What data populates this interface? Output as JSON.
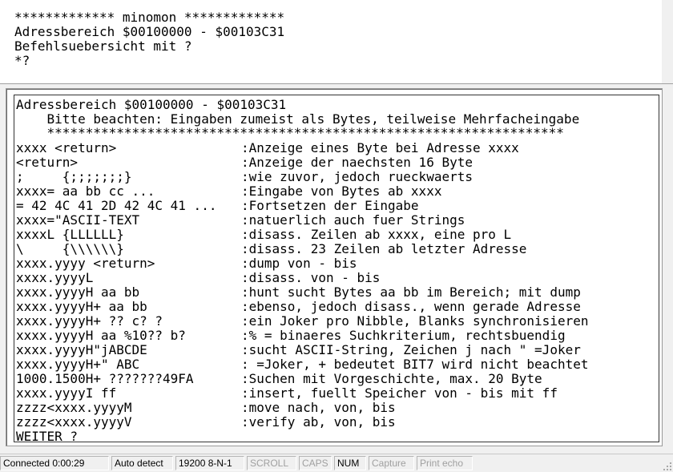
{
  "terminal": {
    "lines": [
      "************* minomon *************",
      "Adressbereich $00100000 - $00103C31",
      "Befehlsuebersicht mit ?",
      "*?"
    ]
  },
  "help": {
    "header": "Adressbereich $00100000 - $00103C31",
    "notice": "    Bitte beachten: Eingaben zumeist als Bytes, teilweise Mehrfacheingabe",
    "separator": "    *******************************************************************",
    "commands": [
      {
        "cmd": "xxxx <return>",
        "desc": ":Anzeige eines Byte bei Adresse xxxx"
      },
      {
        "cmd": "<return>",
        "desc": ":Anzeige der naechsten 16 Byte"
      },
      {
        "cmd": ";     {;;;;;;;}",
        "desc": ":wie zuvor, jedoch rueckwaerts"
      },
      {
        "cmd": "xxxx= aa bb cc ...",
        "desc": ":Eingabe von Bytes ab xxxx"
      },
      {
        "cmd": "= 42 4C 41 2D 42 4C 41 ...",
        "desc": ":Fortsetzen der Eingabe"
      },
      {
        "cmd": "xxxx=\"ASCII-TEXT",
        "desc": ":natuerlich auch fuer Strings"
      },
      {
        "cmd": "xxxxL {LLLLLL}",
        "desc": ":disass. Zeilen ab xxxx, eine pro L"
      },
      {
        "cmd": "\\     {\\\\\\\\\\\\}",
        "desc": ":disass. 23 Zeilen ab letzter Adresse"
      },
      {
        "cmd": "xxxx.yyyy <return>",
        "desc": ":dump von - bis"
      },
      {
        "cmd": "xxxx.yyyyL",
        "desc": ":disass. von - bis"
      },
      {
        "cmd": "xxxx.yyyyH aa bb",
        "desc": ":hunt sucht Bytes aa bb im Bereich; mit dump"
      },
      {
        "cmd": "xxxx.yyyyH+ aa bb",
        "desc": ":ebenso, jedoch disass., wenn gerade Adresse"
      },
      {
        "cmd": "xxxx.yyyyH+ ?? c? ?",
        "desc": ":ein Joker pro Nibble, Blanks synchronisieren"
      },
      {
        "cmd": "xxxx.yyyyH aa %10?? b?",
        "desc": ":% = binaeres Suchkriterium, rechtsbuendig"
      },
      {
        "cmd": "xxxx.yyyyH\"jABCDE",
        "desc": ":sucht ASCII-String, Zeichen j nach \" =Joker"
      },
      {
        "cmd": "xxxx.yyyyH+\" ABC",
        "desc": ": =Joker, + bedeutet BIT7 wird nicht beachtet"
      },
      {
        "cmd": "1000.1500H+ ???????49FA",
        "desc": ":Suchen mit Vorgeschichte, max. 20 Byte"
      },
      {
        "cmd": "xxxx.yyyyI ff",
        "desc": ":insert, fuellt Speicher von - bis mit ff"
      },
      {
        "cmd": "zzzz<xxxx.yyyyM",
        "desc": ":move nach, von, bis"
      },
      {
        "cmd": "zzzz<xxxx.yyyyV",
        "desc": ":verify ab, von, bis"
      }
    ],
    "prompt": "WEITER ?"
  },
  "statusbar": {
    "connected": "Connected 0:00:29",
    "detect": "Auto detect",
    "port": "19200 8-N-1",
    "scroll": "SCROLL",
    "caps": "CAPS",
    "num": "NUM",
    "capture": "Capture",
    "print_echo": "Print echo"
  }
}
